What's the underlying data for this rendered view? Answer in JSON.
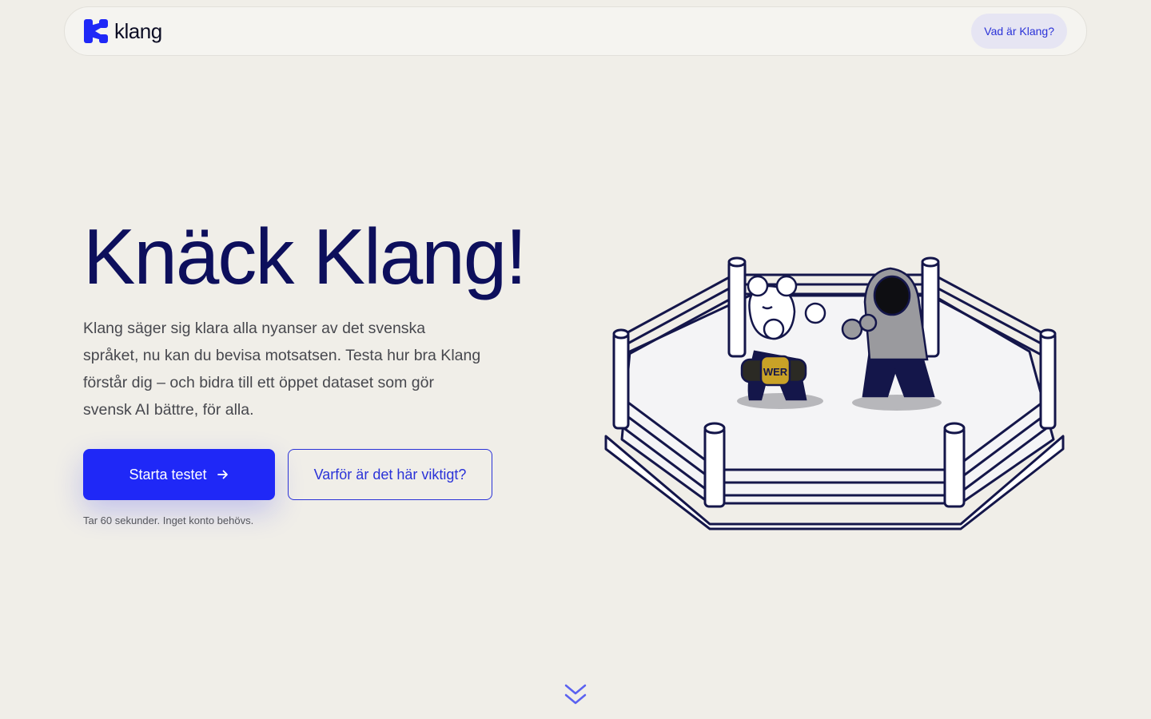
{
  "header": {
    "brand_name": "klang",
    "nav_link": "Vad är Klang?"
  },
  "hero": {
    "title": "Knäck Klang!",
    "body": "Klang säger sig klara alla nyanser av det svenska språket, nu kan du bevisa motsatsen. Testa hur bra Klang förstår dig – och bidra till ett öppet dataset som gör svensk AI bättre, för alla.",
    "primary_button": "Starta testet",
    "secondary_button": "Varför är det här viktigt?",
    "hint": "Tar 60 sekunder. Inget konto behövs."
  },
  "illustration": {
    "belt_text": "WER"
  },
  "colors": {
    "background": "#f0eee8",
    "accent": "#1f28f7",
    "heading": "#0d0f5c",
    "nav_pill_bg": "#e6e5f3"
  },
  "icons": {
    "logo": "klang-logo-icon",
    "button_arrow": "arrow-right-icon",
    "scroll": "double-chevron-down-icon"
  }
}
